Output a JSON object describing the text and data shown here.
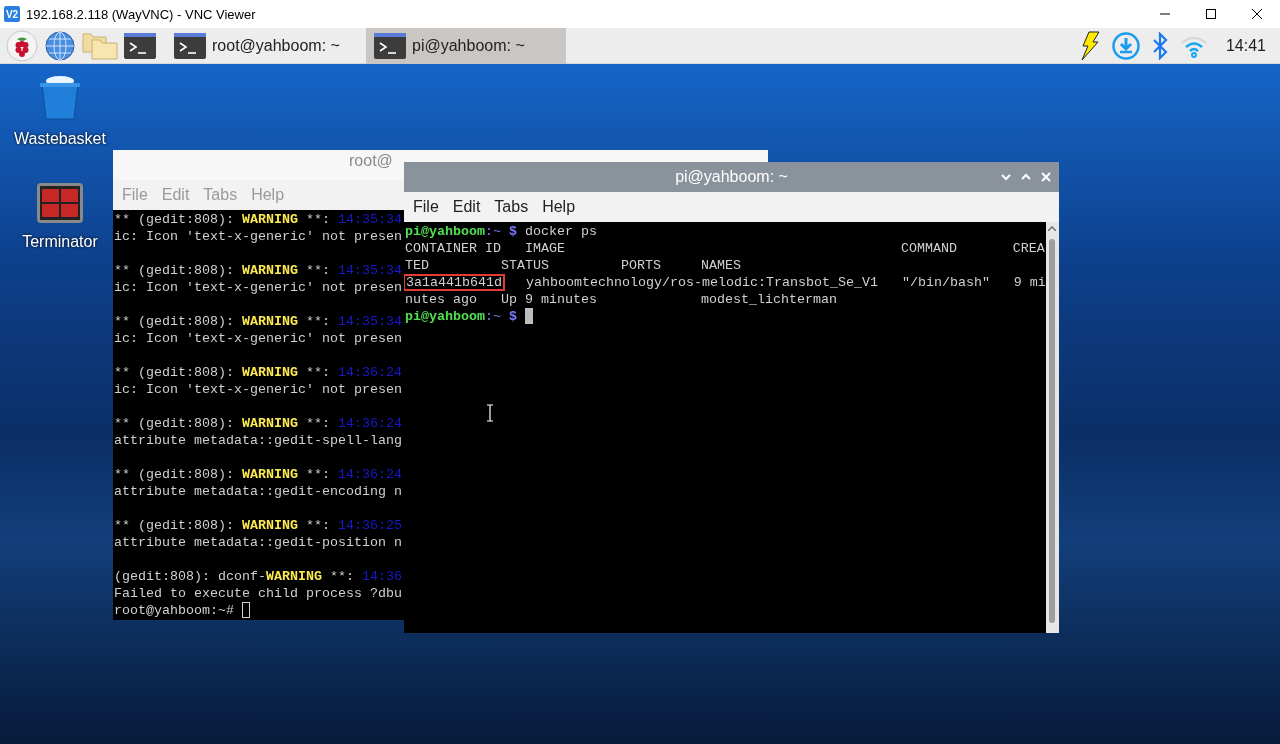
{
  "viewer": {
    "logo": "V2",
    "title": "192.168.2.118 (WayVNC) - VNC Viewer"
  },
  "taskbar": {
    "tasks": [
      {
        "label": "root@yahboom: ~",
        "selected": false
      },
      {
        "label": "pi@yahboom: ~",
        "selected": true
      }
    ],
    "clock": "14:41"
  },
  "desktop_icons": [
    {
      "kind": "trash",
      "label": "Wastebasket"
    },
    {
      "kind": "terminator",
      "label": "Terminator"
    }
  ],
  "windows": [
    {
      "title": "root@",
      "active": false,
      "menu": [
        "File",
        "Edit",
        "Tabs",
        "Help"
      ],
      "blocks": [
        [
          {
            "segments": [
              {
                "text": "** (gedit:808): ",
                "kind": "plain"
              },
              {
                "text": "WARNING",
                "kind": "warn"
              },
              {
                "text": " **: ",
                "kind": "plain"
              },
              {
                "text": "14:35:34",
                "kind": "time"
              }
            ]
          },
          {
            "segments": [
              {
                "text": "ic: Icon 'text-x-generic' not presen",
                "kind": "plain"
              }
            ]
          }
        ],
        [
          {
            "segments": [
              {
                "text": "** (gedit:808): ",
                "kind": "plain"
              },
              {
                "text": "WARNING",
                "kind": "warn"
              },
              {
                "text": " **: ",
                "kind": "plain"
              },
              {
                "text": "14:35:34",
                "kind": "time"
              }
            ]
          },
          {
            "segments": [
              {
                "text": "ic: Icon 'text-x-generic' not presen",
                "kind": "plain"
              }
            ]
          }
        ],
        [
          {
            "segments": [
              {
                "text": "** (gedit:808): ",
                "kind": "plain"
              },
              {
                "text": "WARNING",
                "kind": "warn"
              },
              {
                "text": " **: ",
                "kind": "plain"
              },
              {
                "text": "14:35:34",
                "kind": "time"
              }
            ]
          },
          {
            "segments": [
              {
                "text": "ic: Icon 'text-x-generic' not presen",
                "kind": "plain"
              }
            ]
          }
        ],
        [
          {
            "segments": [
              {
                "text": "** (gedit:808): ",
                "kind": "plain"
              },
              {
                "text": "WARNING",
                "kind": "warn"
              },
              {
                "text": " **: ",
                "kind": "plain"
              },
              {
                "text": "14:36:24",
                "kind": "time"
              }
            ]
          },
          {
            "segments": [
              {
                "text": "ic: Icon 'text-x-generic' not presen",
                "kind": "plain"
              }
            ]
          }
        ],
        [
          {
            "segments": [
              {
                "text": "** (gedit:808): ",
                "kind": "plain"
              },
              {
                "text": "WARNING",
                "kind": "warn"
              },
              {
                "text": " **: ",
                "kind": "plain"
              },
              {
                "text": "14:36:24",
                "kind": "time"
              }
            ]
          },
          {
            "segments": [
              {
                "text": "attribute metadata::gedit-spell-lang",
                "kind": "plain"
              }
            ]
          }
        ],
        [
          {
            "segments": [
              {
                "text": "** (gedit:808): ",
                "kind": "plain"
              },
              {
                "text": "WARNING",
                "kind": "warn"
              },
              {
                "text": " **: ",
                "kind": "plain"
              },
              {
                "text": "14:36:24",
                "kind": "time"
              }
            ]
          },
          {
            "segments": [
              {
                "text": "attribute metadata::gedit-encoding n",
                "kind": "plain"
              }
            ]
          }
        ],
        [
          {
            "segments": [
              {
                "text": "** (gedit:808): ",
                "kind": "plain"
              },
              {
                "text": "WARNING",
                "kind": "warn"
              },
              {
                "text": " **: ",
                "kind": "plain"
              },
              {
                "text": "14:36:25",
                "kind": "time"
              }
            ]
          },
          {
            "segments": [
              {
                "text": "attribute metadata::gedit-position n",
                "kind": "plain"
              }
            ]
          }
        ],
        [
          {
            "segments": [
              {
                "text": "(gedit:808): dconf-",
                "kind": "plain"
              },
              {
                "text": "WARNING",
                "kind": "warn"
              },
              {
                "text": " **: ",
                "kind": "plain"
              },
              {
                "text": "14:36",
                "kind": "time"
              }
            ]
          },
          {
            "segments": [
              {
                "text": "Failed to execute child process ?dbu",
                "kind": "plain"
              }
            ]
          },
          {
            "segments": [
              {
                "text": "root@yahboom:~#",
                "kind": "plain"
              }
            ],
            "cursor": true
          }
        ]
      ]
    },
    {
      "title": "pi@yahboom: ~",
      "active": true,
      "menu": [
        "File",
        "Edit",
        "Tabs",
        "Help"
      ],
      "blocks": [
        [
          {
            "segments": [
              {
                "text": "pi@yahboom",
                "kind": "user"
              },
              {
                "text": ":~ ",
                "kind": "path"
              },
              {
                "text": "$",
                "kind": "sign"
              },
              {
                "text": " docker ps",
                "kind": "plain"
              }
            ]
          },
          {
            "segments": [
              {
                "text": "CONTAINER ID   IMAGE                                          COMMAND       CREA",
                "kind": "plain"
              }
            ]
          },
          {
            "segments": [
              {
                "text": "TED         STATUS         PORTS     NAMES",
                "kind": "plain"
              }
            ]
          },
          {
            "boxed": "3a1a441b641d",
            "segments": [
              {
                "text": "   yahboomtechnology/ros-melodic:Transbot_Se_V1   \"/bin/bash\"   9 mi",
                "kind": "plain"
              }
            ]
          },
          {
            "segments": [
              {
                "text": "nutes ago   Up 9 minutes             modest_lichterman",
                "kind": "plain"
              }
            ]
          },
          {
            "segments": [
              {
                "text": "pi@yahboom",
                "kind": "user"
              },
              {
                "text": ":~ ",
                "kind": "path"
              },
              {
                "text": "$",
                "kind": "sign"
              }
            ],
            "cursor": true
          }
        ]
      ]
    }
  ]
}
